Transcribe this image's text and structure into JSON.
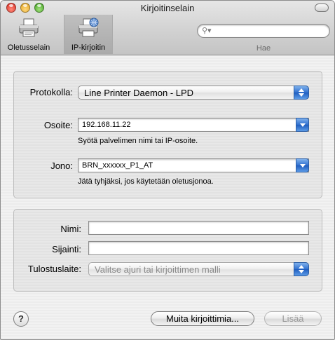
{
  "window": {
    "title": "Kirjoitinselain"
  },
  "toolbar": {
    "items": [
      {
        "label": "Oletusselain",
        "icon": "printer-icon",
        "selected": false
      },
      {
        "label": "IP-kirjoitin",
        "icon": "network-printer-icon",
        "selected": true
      }
    ],
    "search": {
      "label": "Hae",
      "placeholder": "",
      "icon": "search-icon"
    }
  },
  "connection": {
    "protocol_label": "Protokolla:",
    "protocol_value": "Line Printer Daemon - LPD",
    "address_label": "Osoite:",
    "address_value": "192.168.11.22",
    "address_hint": "Syötä palvelimen nimi tai IP-osoite.",
    "queue_label": "Jono:",
    "queue_value": "BRN_xxxxxx_P1_AT",
    "queue_hint": "Jätä tyhjäksi, jos käytetään oletusjonoa."
  },
  "details": {
    "name_label": "Nimi:",
    "name_value": "",
    "location_label": "Sijainti:",
    "location_value": "",
    "device_label": "Tulostuslaite:",
    "device_value": "Valitse ajuri tai kirjoittimen malli"
  },
  "footer": {
    "help_label": "?",
    "more_printers_label": "Muita kirjoittimia...",
    "add_label": "Lisää"
  },
  "colors": {
    "accent_blue": "#2f6fcf",
    "window_bg": "#ececec"
  }
}
